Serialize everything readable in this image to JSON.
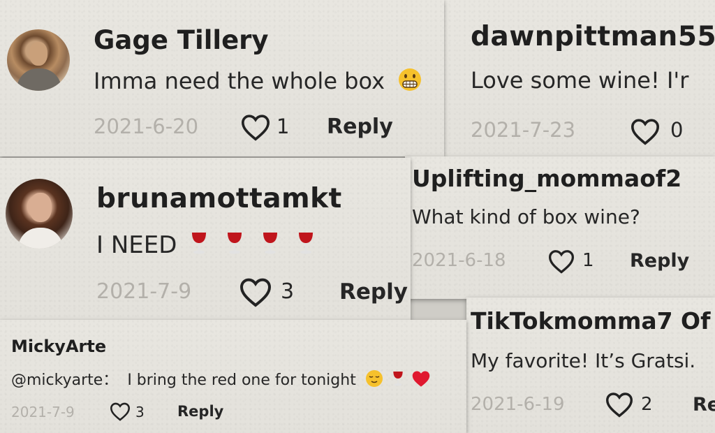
{
  "comments": [
    {
      "username": "Gage Tillery",
      "text": "Imma need the whole box",
      "date": "2021-6-20",
      "likes": "1",
      "reply": "Reply",
      "emoji_icons": [
        "grimacing-face-icon"
      ]
    },
    {
      "username": "dawnpittman55",
      "text": "Love some wine! I'r",
      "date": "2021-7-23",
      "likes": "0",
      "reply": ""
    },
    {
      "username": "brunamottamkt",
      "text": "I NEED",
      "date": "2021-7-9",
      "likes": "3",
      "reply": "Reply",
      "emoji_icons": [
        "wine-glass-icon",
        "wine-glass-icon",
        "wine-glass-icon",
        "wine-glass-icon"
      ]
    },
    {
      "username": "Uplifting_mommaof2",
      "text": "What kind of box wine?",
      "date": "2021-6-18",
      "likes": "1",
      "reply": "Reply"
    },
    {
      "username": "MickyArte",
      "mention": "@mickyarte：",
      "text": "I bring the red one for tonight",
      "date": "2021-7-9",
      "likes": "3",
      "reply": "Reply",
      "emoji_icons": [
        "relieved-face-icon",
        "wine-glass-icon",
        "red-heart-icon"
      ]
    },
    {
      "username": "TikTokmomma7 Of",
      "text": "My favorite! It’s Gratsi.",
      "date": "2021-6-19",
      "likes": "2",
      "reply": "Re"
    }
  ],
  "colors": {
    "card_bg": "#e7e5df",
    "text": "#232323",
    "date": "#b3b0aa",
    "wine_red": "#c0151c",
    "heart_red": "#e0182f"
  }
}
